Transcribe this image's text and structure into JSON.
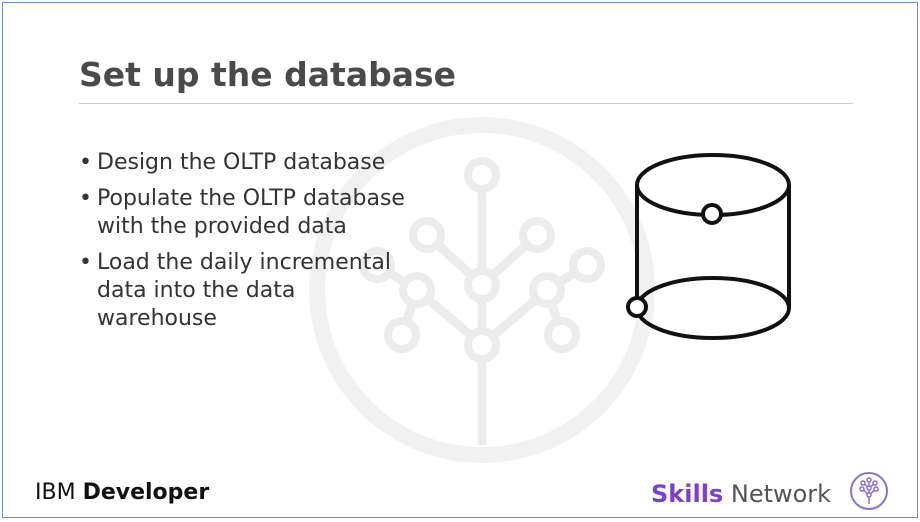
{
  "slide": {
    "title": "Set up the database",
    "bullets": [
      {
        "marker": "•",
        "lines": [
          "Design the OLTP database"
        ]
      },
      {
        "marker": "•",
        "lines": [
          "Populate the OLTP database",
          "with the provided data"
        ]
      },
      {
        "marker": "•",
        "lines": [
          "Load the daily incremental",
          "data into the data",
          "warehouse"
        ]
      }
    ]
  },
  "icons": {
    "database": "database-cylinder-icon",
    "watermark": "skills-network-tree-watermark-icon",
    "brand_logo": "skills-network-tree-icon"
  },
  "footer": {
    "left_brand_part1": "IBM",
    "left_brand_part2": "Developer",
    "right_brand_part1": "Skills",
    "right_brand_part2": "Network"
  },
  "colors": {
    "frame": "#6f8fd6",
    "title": "#4a4a4a",
    "body_text": "#333333",
    "skills_purple": "#7d3fd0",
    "network_gray": "#555555",
    "watermark_gray": "#f0f0f0"
  }
}
